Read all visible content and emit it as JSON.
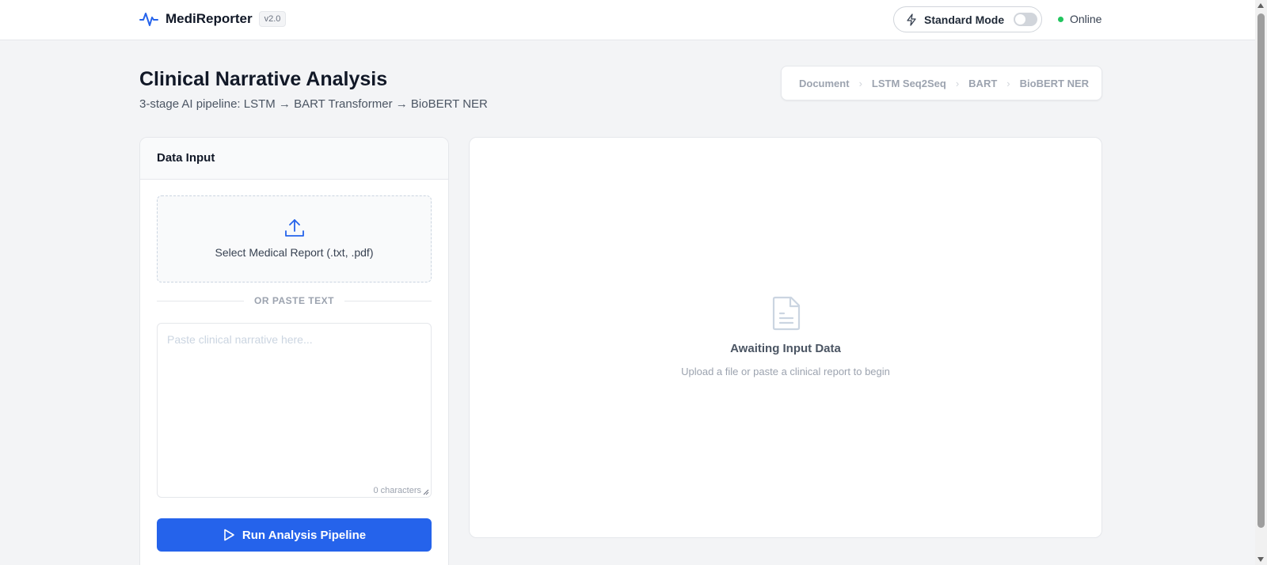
{
  "app": {
    "name": "MediReporter",
    "version": "v2.0"
  },
  "header": {
    "mode_label": "Standard Mode",
    "mode_enabled": false,
    "status_text": "Online",
    "status_color": "#22c55e"
  },
  "page": {
    "title": "Clinical Narrative Analysis",
    "subtitle": "3-stage AI pipeline: LSTM → BART Transformer → BioBERT NER"
  },
  "pipeline": {
    "steps": [
      "Document",
      "LSTM Seq2Seq",
      "BART",
      "BioBERT NER"
    ],
    "separator": "›"
  },
  "input_card": {
    "title": "Data Input",
    "upload_label": "Select Medical Report (.txt, .pdf)",
    "divider_text": "OR PASTE TEXT",
    "textarea_placeholder": "Paste clinical narrative here...",
    "textarea_value": "",
    "char_count": "0 characters",
    "run_button_label": "Run Analysis Pipeline"
  },
  "results_card": {
    "empty_title": "Awaiting Input Data",
    "empty_subtitle": "Upload a file or paste a clinical report to begin"
  },
  "colors": {
    "accent": "#2563eb",
    "background": "#f3f4f6"
  },
  "icons": {
    "logo": "activity-pulse-icon",
    "mode": "lightning-bolt-icon",
    "upload": "upload-icon",
    "run": "play-icon",
    "empty_state": "document-icon"
  }
}
